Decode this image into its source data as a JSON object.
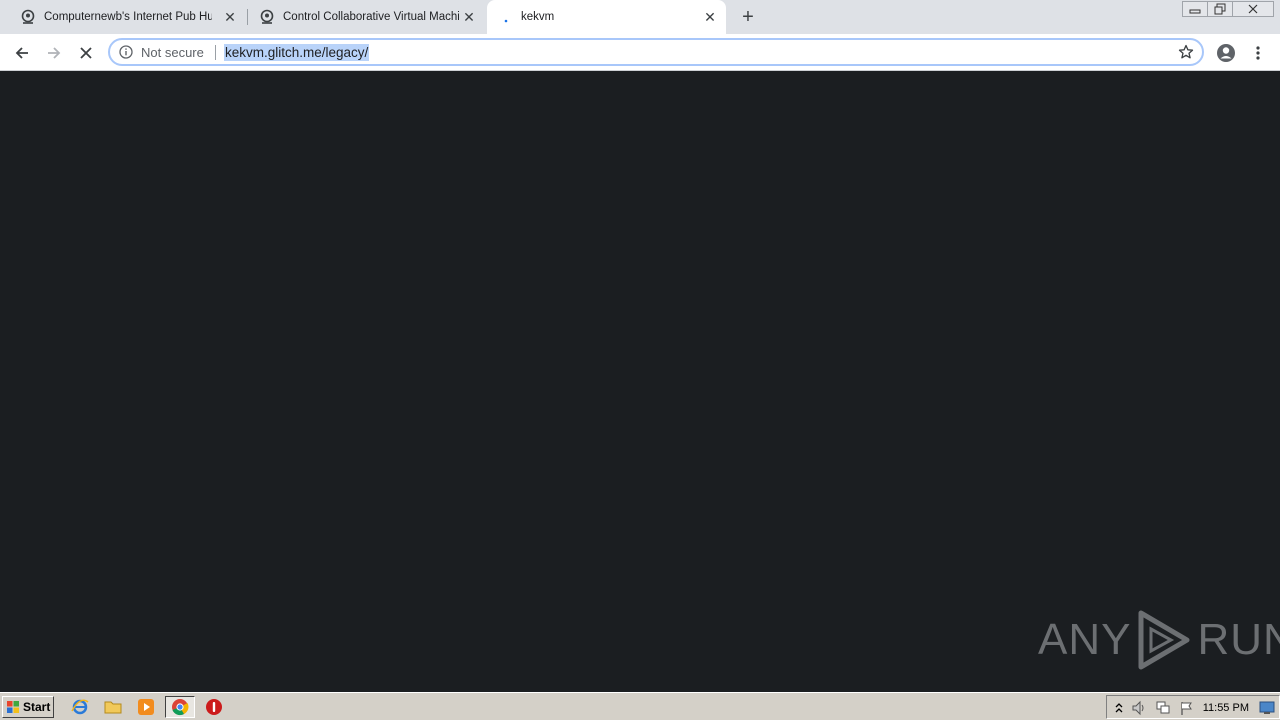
{
  "browser": {
    "tabs": [
      {
        "label": "Computernewb's Internet Pub Hub",
        "active": false
      },
      {
        "label": "Control Collaborative Virtual Machine",
        "active": false
      },
      {
        "label": "kekvm",
        "active": true
      }
    ],
    "address_bar": {
      "security_label": "Not secure",
      "url": "kekvm.glitch.me/legacy/"
    }
  },
  "watermark": {
    "left_text": "ANY",
    "right_text": "RUN"
  },
  "taskbar": {
    "start_label": "Start",
    "clock": "11:55 PM"
  },
  "colors": {
    "page_background": "#1b1e21",
    "tabstrip": "#dee1e6",
    "url_selection": "#b9d3f9",
    "taskbar": "#d4d0c8",
    "watermark": "#6c6f72"
  }
}
